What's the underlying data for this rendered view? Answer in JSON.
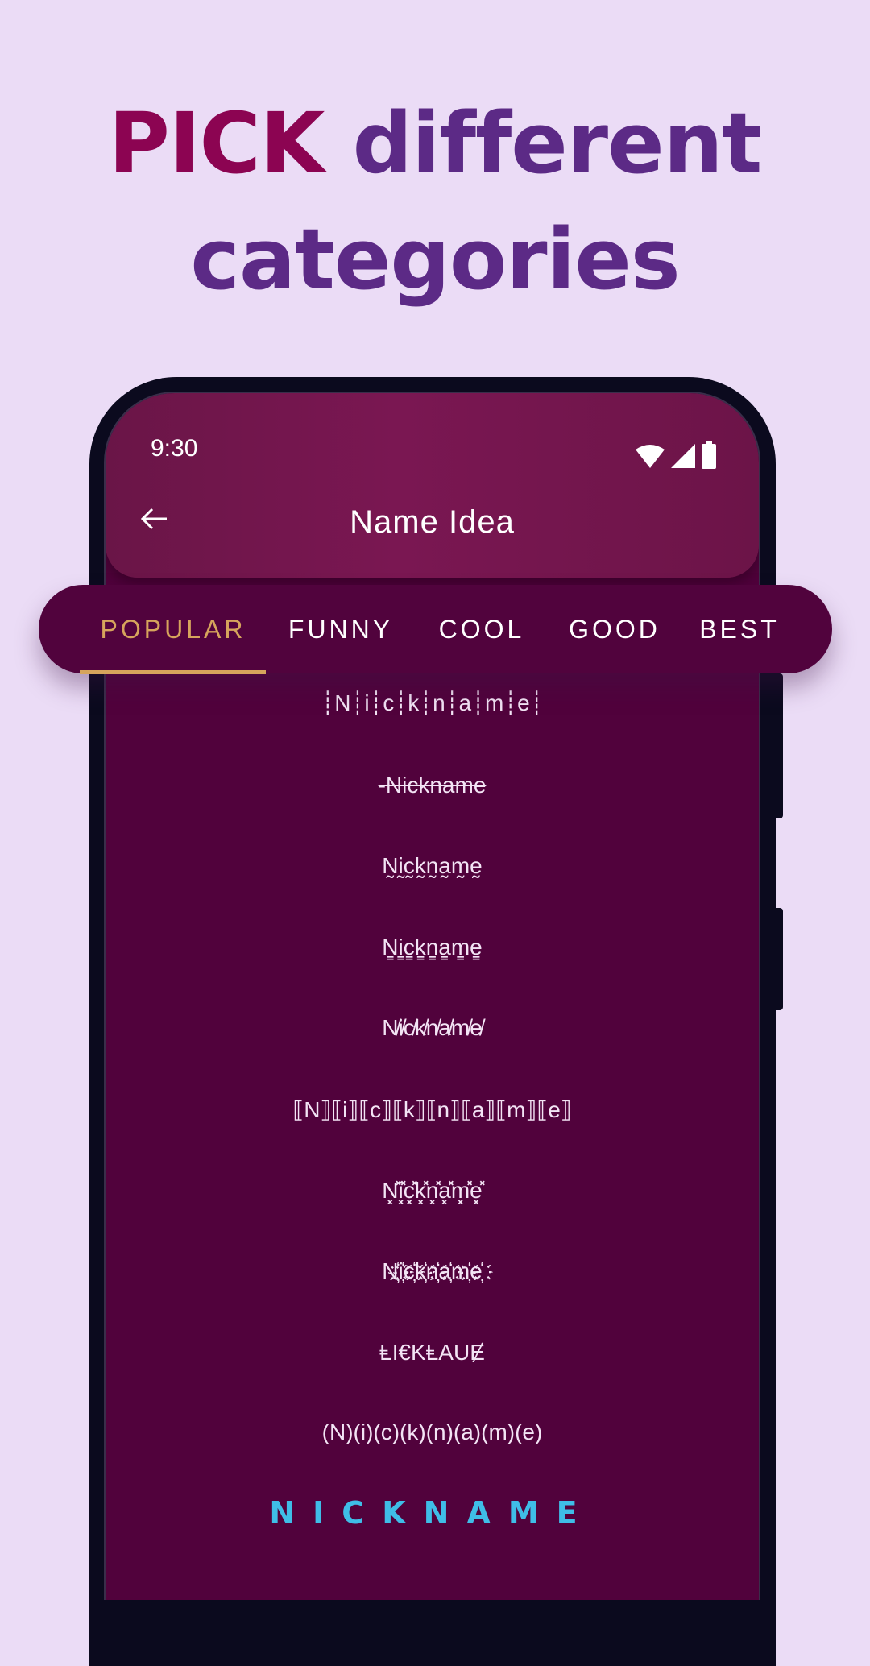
{
  "headline": {
    "accent_word": "PICK",
    "line1_rest": " different",
    "line2": "categories",
    "accent_color": "#8c0452",
    "text_color": "#5c2a86"
  },
  "status_bar": {
    "time": "9:30",
    "icons": [
      "wifi-icon",
      "cellular-signal-icon",
      "battery-icon"
    ]
  },
  "app_bar": {
    "back_icon": "arrow-left-icon",
    "title": "Name Idea"
  },
  "tabs": [
    {
      "label": "POPULAR",
      "active": true
    },
    {
      "label": "FUNNY",
      "active": false
    },
    {
      "label": "COOL",
      "active": false
    },
    {
      "label": "GOOD",
      "active": false
    },
    {
      "label": "BEST",
      "active": false
    }
  ],
  "tab_active_color": "#d6a45c",
  "nickname_styles": [
    "┊N┊i┊c┊k┊n┊a┊m┊e┊",
    "-Nickname",
    "N̰ḭc̰k̰n̰a̰m̰ḛ",
    "N̳i̳c̳k̳n̳a̳m̳e̳",
    "N̸i̸c̸k̸n̸a̸m̸e̸",
    "⟦N⟧⟦i⟧⟦c⟧⟦k⟧⟦n⟧⟦a⟧⟦m⟧⟦e⟧",
    "N͓̽i͓̽c͓̽k͓̽n͓̽a͓̽m͓̽e͓̽",
    "N҉i҉c҉k҉n҉a҉m҉e҉",
    "ⱠI€KⱠAUɆ",
    "(N)(i)(c)(k)(n)(a)(m)(e)",
    "NICKNAME"
  ]
}
